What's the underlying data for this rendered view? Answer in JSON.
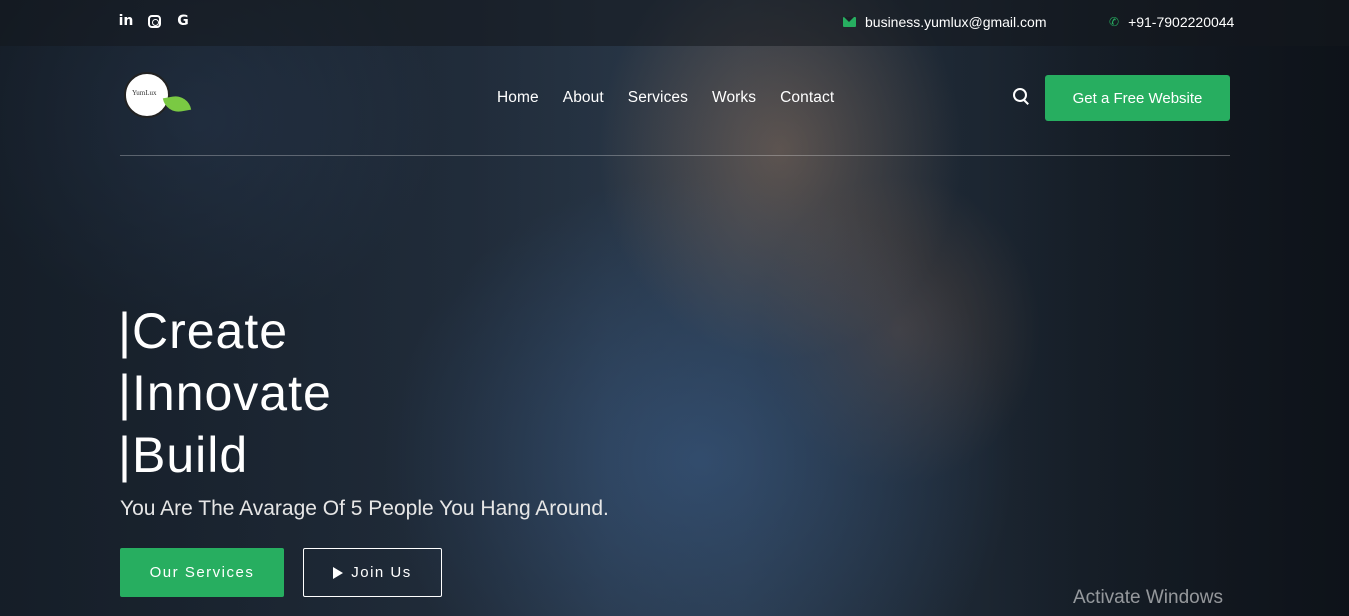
{
  "topbar": {
    "social": [
      {
        "icon": "linkedin-icon",
        "glyph": "in"
      },
      {
        "icon": "instagram-icon",
        "glyph": ""
      },
      {
        "icon": "google-icon",
        "glyph": "G"
      }
    ],
    "email": "business.yumlux@gmail.com",
    "phone": "+91-7902220044"
  },
  "header": {
    "logo_text": "YumLux",
    "nav": [
      "Home",
      "About",
      "Services",
      "Works",
      "Contact"
    ],
    "cta_label": "Get a Free Website"
  },
  "hero": {
    "headline": [
      "|Create",
      "|Innovate",
      "|Build"
    ],
    "tagline": "You Are The Avarage Of 5 People You Hang Around.",
    "primary_button": "Our Services",
    "secondary_button": "Join Us"
  },
  "watermark": "Activate Windows",
  "colors": {
    "accent": "#27ae60"
  }
}
